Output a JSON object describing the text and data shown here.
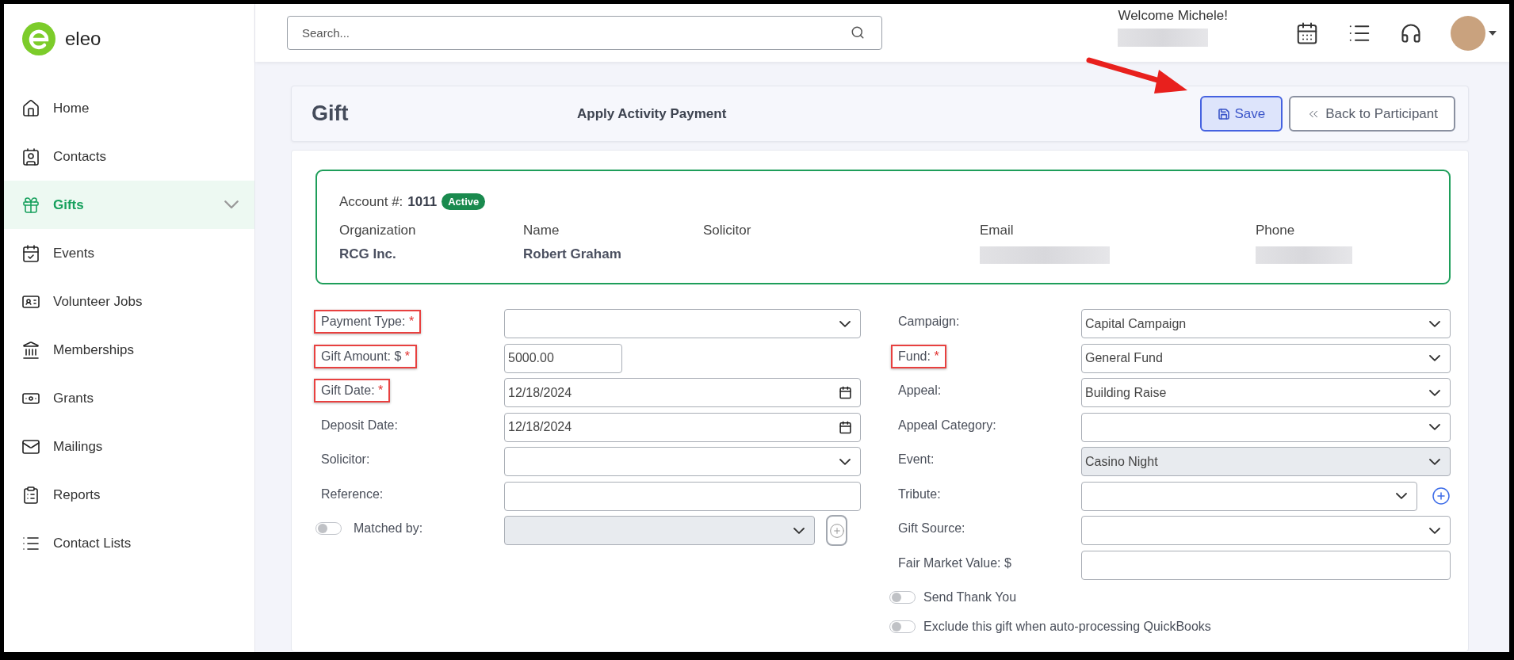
{
  "app": {
    "name": "eleo"
  },
  "sidebar": {
    "items": [
      {
        "label": "Home",
        "selected": false,
        "expandable": false
      },
      {
        "label": "Contacts",
        "selected": false,
        "expandable": false
      },
      {
        "label": "Gifts",
        "selected": true,
        "expandable": true
      },
      {
        "label": "Events",
        "selected": false,
        "expandable": false
      },
      {
        "label": "Volunteer Jobs",
        "selected": false,
        "expandable": false
      },
      {
        "label": "Memberships",
        "selected": false,
        "expandable": false
      },
      {
        "label": "Grants",
        "selected": false,
        "expandable": false
      },
      {
        "label": "Mailings",
        "selected": false,
        "expandable": false
      },
      {
        "label": "Reports",
        "selected": false,
        "expandable": false
      },
      {
        "label": "Contact Lists",
        "selected": false,
        "expandable": false
      }
    ]
  },
  "topbar": {
    "search": {
      "placeholder": "Search..."
    },
    "welcome": "Welcome Michele!",
    "user_redacted": true
  },
  "header": {
    "title": "Gift",
    "subtitle": "Apply Activity Payment",
    "buttons": [
      {
        "label": "Save",
        "kind": "primary"
      },
      {
        "label": "Back to Participant",
        "kind": "secondary"
      }
    ],
    "arrow_annotation": true
  },
  "account": {
    "label": "Account #:",
    "number": "1011",
    "status": "Active",
    "columns": [
      {
        "label": "Organization",
        "value": "RCG Inc."
      },
      {
        "label": "Name",
        "value": "Robert Graham"
      },
      {
        "label": "Solicitor"
      },
      {
        "label": "Email",
        "redacted": true
      },
      {
        "label": "Phone",
        "redacted": true
      }
    ]
  },
  "form": {
    "left": [
      {
        "label": "Payment Type:",
        "marker": "*",
        "highlighted": true,
        "kind": "select",
        "disabled": false
      },
      {
        "label": "Gift Amount: $",
        "marker": "*",
        "highlighted": true,
        "kind": "amount",
        "value": "5000.00"
      },
      {
        "label": "Gift Date:",
        "marker": "*",
        "highlighted": true,
        "kind": "date",
        "value": "12/18/2024"
      },
      {
        "label": "Deposit Date:",
        "highlighted": false,
        "kind": "date",
        "value": "12/18/2024"
      },
      {
        "label": "Solicitor:",
        "highlighted": false,
        "kind": "select",
        "disabled": false
      },
      {
        "label": "Reference:",
        "highlighted": false,
        "kind": "text"
      },
      {
        "label": "Matched by:",
        "highlighted": false,
        "kind": "toggle-select",
        "on": false,
        "disabled": true
      }
    ],
    "right": [
      {
        "label": "Campaign:",
        "highlighted": false,
        "kind": "select",
        "value": "Capital Campaign",
        "disabled": false
      },
      {
        "label": "Fund:",
        "marker": "*",
        "highlighted": true,
        "kind": "select",
        "value": "General Fund",
        "disabled": false
      },
      {
        "label": "Appeal:",
        "highlighted": false,
        "kind": "select",
        "value": "Building Raise",
        "disabled": false
      },
      {
        "label": "Appeal Category:",
        "highlighted": false,
        "kind": "select",
        "disabled": false
      },
      {
        "label": "Event:",
        "highlighted": false,
        "kind": "select",
        "value": "Casino Night",
        "disabled": true
      },
      {
        "label": "Tribute:",
        "highlighted": false,
        "kind": "select-add",
        "disabled": false
      },
      {
        "label": "Gift Source:",
        "highlighted": false,
        "kind": "select",
        "disabled": false
      },
      {
        "label": "Fair Market Value: $",
        "highlighted": false,
        "kind": "text"
      }
    ],
    "toggles": [
      {
        "label": "Send Thank You",
        "on": false
      },
      {
        "label": "Exclude this gift when auto-processing QuickBooks",
        "on": false
      }
    ]
  }
}
